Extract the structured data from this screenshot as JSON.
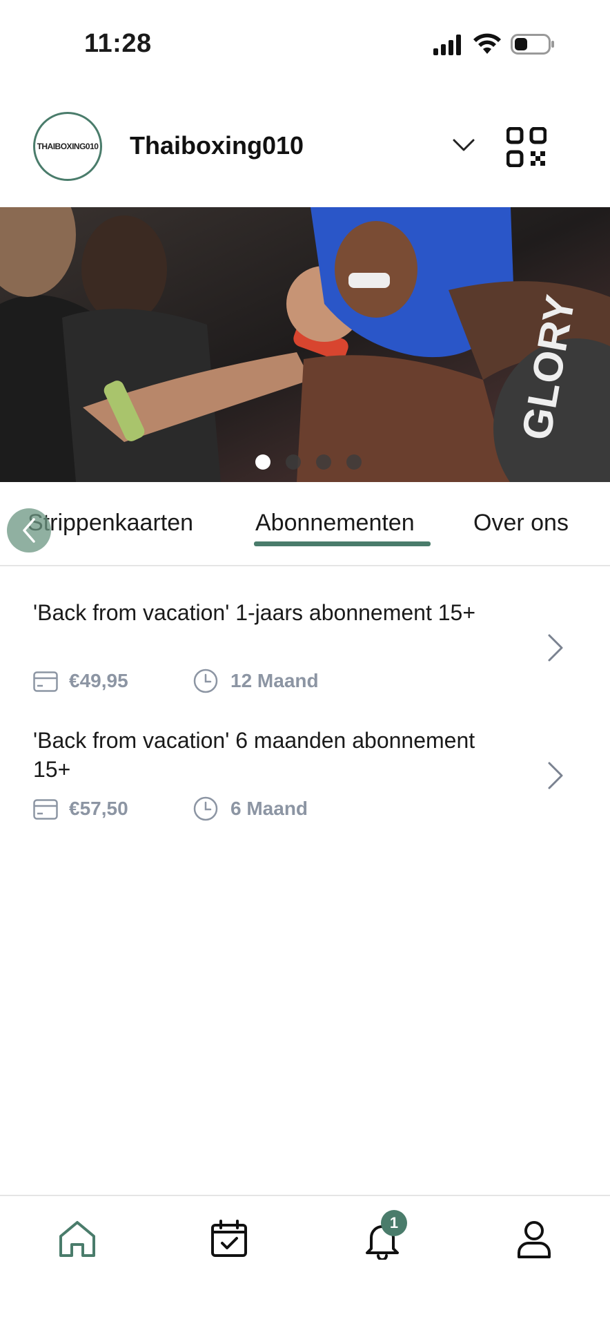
{
  "status_bar": {
    "time": "11:28"
  },
  "header": {
    "club_name": "Thaiboxing010",
    "logo_text": "THAIBOXING010"
  },
  "carousel": {
    "slide_count": 4,
    "active_index": 0
  },
  "tabs": [
    {
      "label": "Strippenkaarten",
      "active": false
    },
    {
      "label": "Abonnementen",
      "active": true
    },
    {
      "label": "Over ons",
      "active": false
    }
  ],
  "subscriptions": [
    {
      "title": "'Back from vacation' 1-jaars abonnement 15+",
      "price": "€49,95",
      "duration": "12 Maand"
    },
    {
      "title": "'Back from vacation' 6 maanden abonnement 15+",
      "price": "€57,50",
      "duration": "6 Maand"
    }
  ],
  "bottom_nav": {
    "items": [
      "home-icon",
      "calendar-check-icon",
      "bell-icon",
      "profile-icon"
    ],
    "notification_count": "1"
  },
  "colors": {
    "accent": "#4a7c6b",
    "meta_text": "#8c95a3"
  }
}
